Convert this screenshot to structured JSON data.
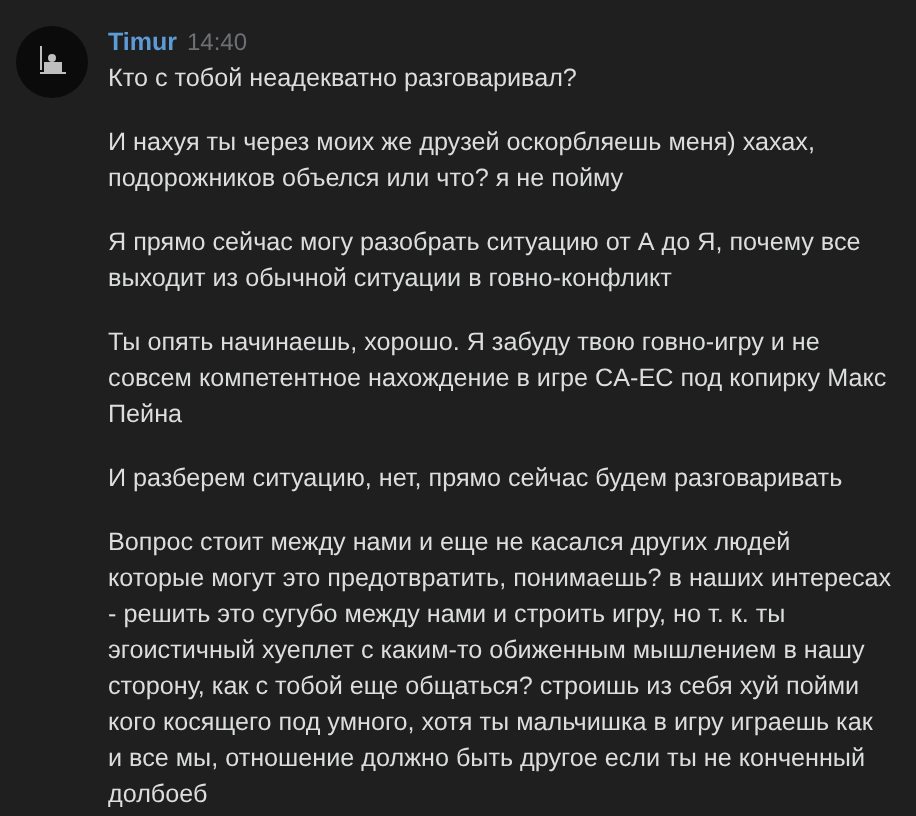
{
  "message": {
    "author": "Timur",
    "time": "14:40",
    "paragraphs": [
      "Кто с тобой неадекватно разговаривал?",
      "И нахуя ты через моих же друзей оскорбляешь меня) хахах, подорожников объелся или что? я не пойму",
      "Я прямо сейчас могу разобрать ситуацию от А до Я, почему все выходит из обычной ситуации в говно-конфликт",
      "Ты опять начинаешь, хорошо. Я забуду твою говно-игру и не совсем компетентное нахождение в игре CA-EC под копирку Макс Пейна",
      "И разберем ситуацию, нет, прямо сейчас будем разговаривать",
      "Вопрос стоит между нами и еще не касался других людей которые могут это предотвратить, понимаешь? в наших интересах - решить это сугубо между нами и строить игру, но т. к. ты эгоистичный хуеплет с каким-то обиженным мышлением в нашу сторону, как с тобой еще общаться? строишь из себя хуй пойми кого косящего под умного, хотя ты мальчишка в игру играешь как и все мы, отношение должно быть другое если ты не конченный долбоеб"
    ]
  }
}
